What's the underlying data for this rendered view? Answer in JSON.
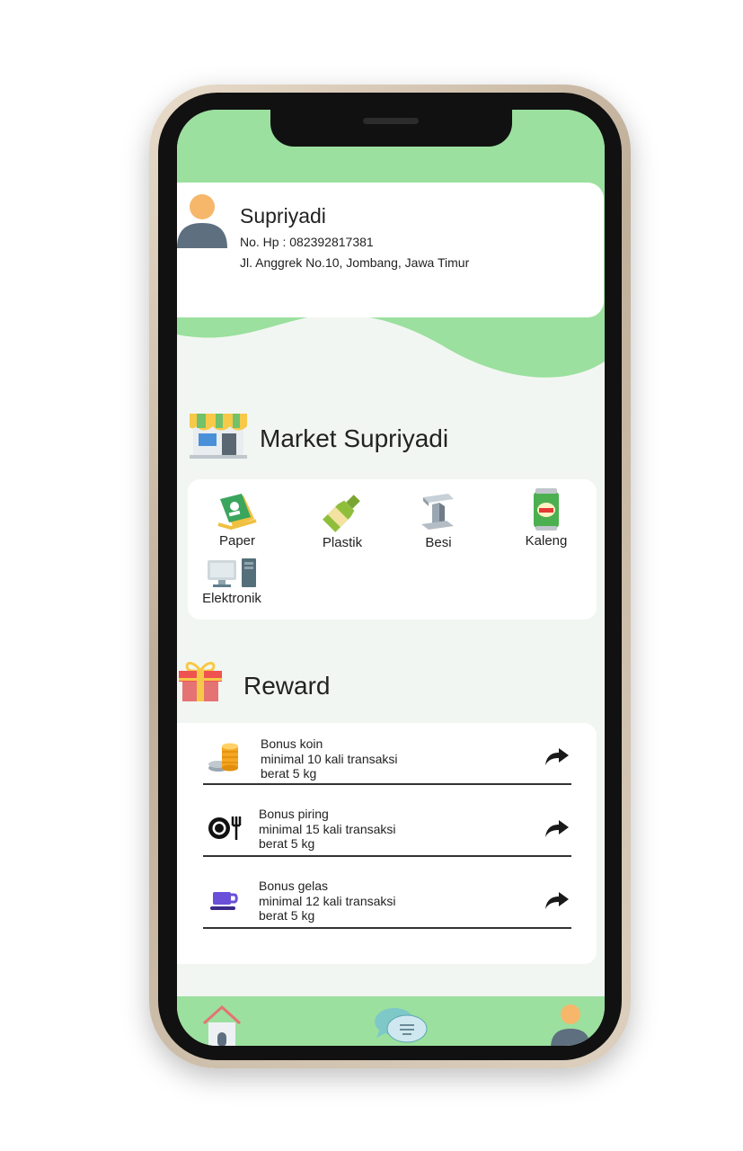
{
  "profile": {
    "name": "Supriyadi",
    "phone": "No. Hp : 082392817381",
    "address": "Jl. Anggrek No.10, Jombang, Jawa Timur"
  },
  "market": {
    "title": "Market Supriyadi",
    "categories": [
      {
        "label": "Paper",
        "icon": "paper-icon"
      },
      {
        "label": "Plastik",
        "icon": "bottle-icon"
      },
      {
        "label": "Besi",
        "icon": "iron-beam-icon"
      },
      {
        "label": "Kaleng",
        "icon": "can-icon"
      },
      {
        "label": "Elektronik",
        "icon": "computer-icon"
      }
    ]
  },
  "reward": {
    "title": "Reward",
    "items": [
      {
        "title": "Bonus koin",
        "req": "minimal 10 kali transaksi",
        "weight": "berat 5 kg",
        "icon": "coins-icon"
      },
      {
        "title": "Bonus piring",
        "req": "minimal 15 kali transaksi",
        "weight": "berat 5 kg",
        "icon": "plate-icon"
      },
      {
        "title": "Bonus gelas",
        "req": "minimal 12 kali transaksi",
        "weight": "berat 5 kg",
        "icon": "cup-icon"
      }
    ]
  },
  "nav": {
    "items": [
      {
        "name": "home",
        "icon": "home-icon"
      },
      {
        "name": "chat",
        "icon": "chat-icon"
      },
      {
        "name": "profile",
        "icon": "user-icon"
      }
    ]
  },
  "colors": {
    "accent_green": "#9be09e",
    "background": "#f2f6f2",
    "card": "#ffffff"
  }
}
